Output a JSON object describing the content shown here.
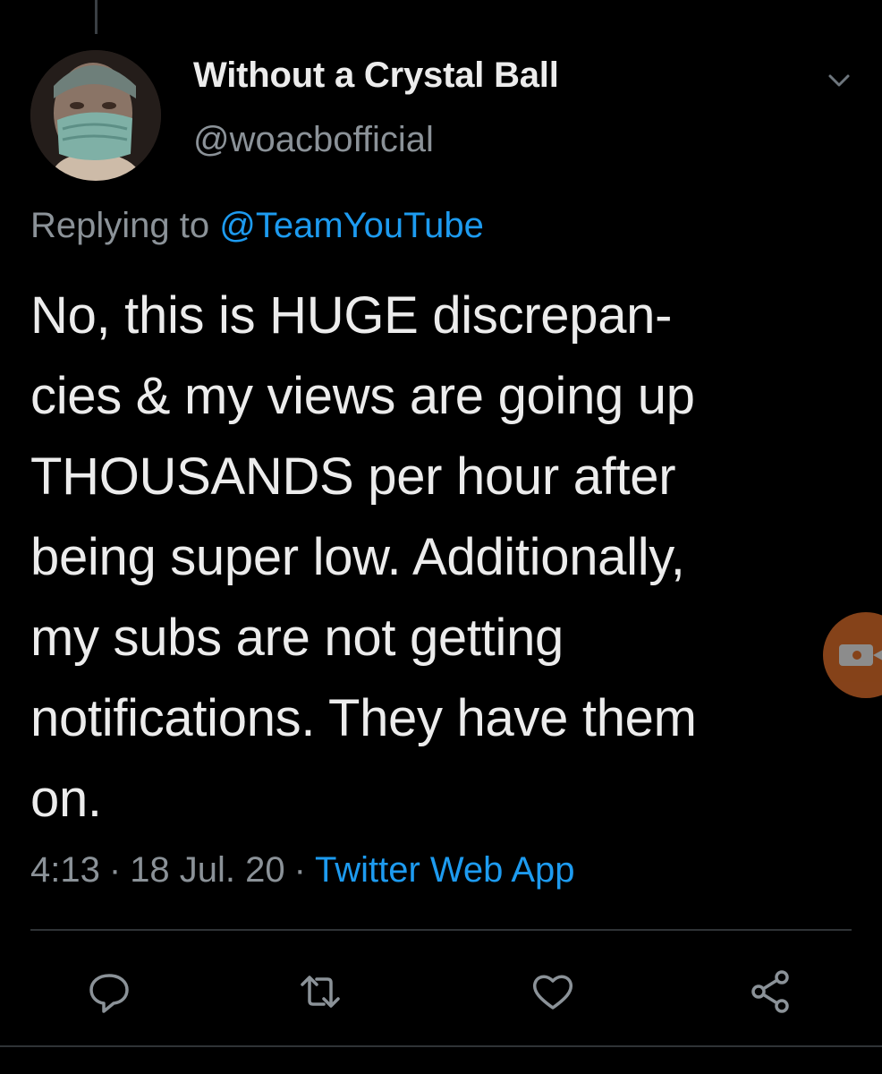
{
  "tweet": {
    "author": {
      "display_name": "Without a Crystal Ball",
      "handle": "@woacbofficial",
      "avatar_icon": "avatar-photo"
    },
    "reply_context": {
      "prefix": "Replying to",
      "mention": "@TeamYouTube"
    },
    "text": "No, this is HUGE discrepan-\ncies & my views are going up\nTHOUSANDS per hour after\nbeing super low. Additionally,\nmy subs are not getting\nnotifications. They have them\non.",
    "time": "4:13",
    "date": "18 Jul. 20",
    "separator": "·",
    "source": "Twitter Web App"
  },
  "actions": [
    {
      "name": "reply",
      "icon": "reply-icon"
    },
    {
      "name": "retweet",
      "icon": "retweet-icon"
    },
    {
      "name": "like",
      "icon": "heart-icon"
    },
    {
      "name": "share",
      "icon": "share-icon"
    }
  ],
  "colors": {
    "background": "#000000",
    "text": "#ececec",
    "secondary_text": "#8b9298",
    "link": "#1d9bf0",
    "divider": "#2f3336",
    "floating_button": "#f2782f"
  }
}
